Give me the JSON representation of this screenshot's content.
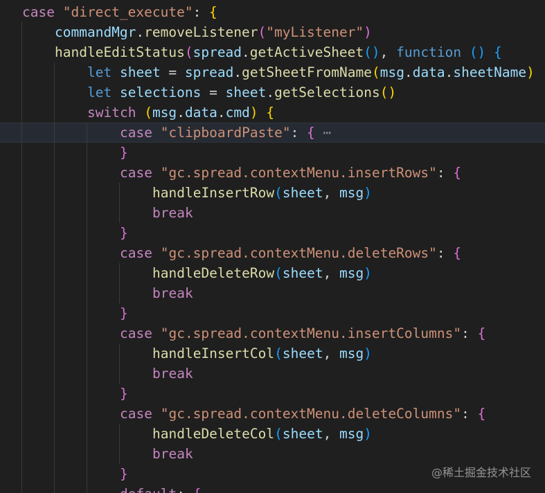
{
  "editor": {
    "lines": [
      {
        "indent": 0,
        "tokens": [
          {
            "text": "case",
            "c": "ctl"
          },
          {
            "text": " ",
            "c": "pun"
          },
          {
            "text": "\"direct_execute\"",
            "c": "str"
          },
          {
            "text": ": ",
            "c": "pun"
          },
          {
            "text": "{",
            "c": "b1"
          }
        ]
      },
      {
        "indent": 1,
        "tokens": [
          {
            "text": "commandMgr",
            "c": "var"
          },
          {
            "text": ".",
            "c": "pun"
          },
          {
            "text": "removeListener",
            "c": "fn"
          },
          {
            "text": "(",
            "c": "b2"
          },
          {
            "text": "\"myListener\"",
            "c": "str"
          },
          {
            "text": ")",
            "c": "b2"
          }
        ]
      },
      {
        "indent": 1,
        "tokens": [
          {
            "text": "handleEditStatus",
            "c": "fn"
          },
          {
            "text": "(",
            "c": "b2"
          },
          {
            "text": "spread",
            "c": "var"
          },
          {
            "text": ".",
            "c": "pun"
          },
          {
            "text": "getActiveSheet",
            "c": "fn"
          },
          {
            "text": "()",
            "c": "b3"
          },
          {
            "text": ", ",
            "c": "pun"
          },
          {
            "text": "function",
            "c": "kw"
          },
          {
            "text": " ",
            "c": "pun"
          },
          {
            "text": "()",
            "c": "b3"
          },
          {
            "text": " ",
            "c": "pun"
          },
          {
            "text": "{",
            "c": "b3"
          }
        ]
      },
      {
        "indent": 2,
        "tokens": [
          {
            "text": "let",
            "c": "kw"
          },
          {
            "text": " ",
            "c": "pun"
          },
          {
            "text": "sheet",
            "c": "var"
          },
          {
            "text": " = ",
            "c": "pun"
          },
          {
            "text": "spread",
            "c": "var"
          },
          {
            "text": ".",
            "c": "pun"
          },
          {
            "text": "getSheetFromName",
            "c": "fn"
          },
          {
            "text": "(",
            "c": "b1"
          },
          {
            "text": "msg",
            "c": "var"
          },
          {
            "text": ".",
            "c": "pun"
          },
          {
            "text": "data",
            "c": "var"
          },
          {
            "text": ".",
            "c": "pun"
          },
          {
            "text": "sheetName",
            "c": "var"
          },
          {
            "text": ")",
            "c": "b1"
          }
        ]
      },
      {
        "indent": 2,
        "tokens": [
          {
            "text": "let",
            "c": "kw"
          },
          {
            "text": " ",
            "c": "pun"
          },
          {
            "text": "selections",
            "c": "var"
          },
          {
            "text": " = ",
            "c": "pun"
          },
          {
            "text": "sheet",
            "c": "var"
          },
          {
            "text": ".",
            "c": "pun"
          },
          {
            "text": "getSelections",
            "c": "fn"
          },
          {
            "text": "()",
            "c": "b1"
          }
        ]
      },
      {
        "indent": 2,
        "tokens": [
          {
            "text": "switch",
            "c": "ctl"
          },
          {
            "text": " ",
            "c": "pun"
          },
          {
            "text": "(",
            "c": "b1"
          },
          {
            "text": "msg",
            "c": "var"
          },
          {
            "text": ".",
            "c": "pun"
          },
          {
            "text": "data",
            "c": "var"
          },
          {
            "text": ".",
            "c": "pun"
          },
          {
            "text": "cmd",
            "c": "var"
          },
          {
            "text": ")",
            "c": "b1"
          },
          {
            "text": " ",
            "c": "pun"
          },
          {
            "text": "{",
            "c": "b1"
          }
        ]
      },
      {
        "indent": 3,
        "current": true,
        "tokens": [
          {
            "text": "case",
            "c": "ctl"
          },
          {
            "text": " ",
            "c": "pun"
          },
          {
            "text": "\"clipboardPaste\"",
            "c": "str"
          },
          {
            "text": ": ",
            "c": "pun"
          },
          {
            "text": "{",
            "c": "b2"
          },
          {
            "text": " ",
            "c": "pun"
          },
          {
            "text": "⋯",
            "c": "fold"
          }
        ]
      },
      {
        "indent": 3,
        "tokens": [
          {
            "text": "}",
            "c": "b2"
          }
        ]
      },
      {
        "indent": 3,
        "tokens": [
          {
            "text": "case",
            "c": "ctl"
          },
          {
            "text": " ",
            "c": "pun"
          },
          {
            "text": "\"gc.spread.contextMenu.insertRows\"",
            "c": "str"
          },
          {
            "text": ": ",
            "c": "pun"
          },
          {
            "text": "{",
            "c": "b2"
          }
        ]
      },
      {
        "indent": 4,
        "tokens": [
          {
            "text": "handleInsertRow",
            "c": "fn"
          },
          {
            "text": "(",
            "c": "b3"
          },
          {
            "text": "sheet",
            "c": "var"
          },
          {
            "text": ", ",
            "c": "pun"
          },
          {
            "text": "msg",
            "c": "var"
          },
          {
            "text": ")",
            "c": "b3"
          }
        ]
      },
      {
        "indent": 4,
        "tokens": [
          {
            "text": "break",
            "c": "ctl"
          }
        ]
      },
      {
        "indent": 3,
        "tokens": [
          {
            "text": "}",
            "c": "b2"
          }
        ]
      },
      {
        "indent": 3,
        "tokens": [
          {
            "text": "case",
            "c": "ctl"
          },
          {
            "text": " ",
            "c": "pun"
          },
          {
            "text": "\"gc.spread.contextMenu.deleteRows\"",
            "c": "str"
          },
          {
            "text": ": ",
            "c": "pun"
          },
          {
            "text": "{",
            "c": "b2"
          }
        ]
      },
      {
        "indent": 4,
        "tokens": [
          {
            "text": "handleDeleteRow",
            "c": "fn"
          },
          {
            "text": "(",
            "c": "b3"
          },
          {
            "text": "sheet",
            "c": "var"
          },
          {
            "text": ", ",
            "c": "pun"
          },
          {
            "text": "msg",
            "c": "var"
          },
          {
            "text": ")",
            "c": "b3"
          }
        ]
      },
      {
        "indent": 4,
        "tokens": [
          {
            "text": "break",
            "c": "ctl"
          }
        ]
      },
      {
        "indent": 3,
        "tokens": [
          {
            "text": "}",
            "c": "b2"
          }
        ]
      },
      {
        "indent": 3,
        "tokens": [
          {
            "text": "case",
            "c": "ctl"
          },
          {
            "text": " ",
            "c": "pun"
          },
          {
            "text": "\"gc.spread.contextMenu.insertColumns\"",
            "c": "str"
          },
          {
            "text": ": ",
            "c": "pun"
          },
          {
            "text": "{",
            "c": "b2"
          }
        ]
      },
      {
        "indent": 4,
        "tokens": [
          {
            "text": "handleInsertCol",
            "c": "fn"
          },
          {
            "text": "(",
            "c": "b3"
          },
          {
            "text": "sheet",
            "c": "var"
          },
          {
            "text": ", ",
            "c": "pun"
          },
          {
            "text": "msg",
            "c": "var"
          },
          {
            "text": ")",
            "c": "b3"
          }
        ]
      },
      {
        "indent": 4,
        "tokens": [
          {
            "text": "break",
            "c": "ctl"
          }
        ]
      },
      {
        "indent": 3,
        "tokens": [
          {
            "text": "}",
            "c": "b2"
          }
        ]
      },
      {
        "indent": 3,
        "tokens": [
          {
            "text": "case",
            "c": "ctl"
          },
          {
            "text": " ",
            "c": "pun"
          },
          {
            "text": "\"gc.spread.contextMenu.deleteColumns\"",
            "c": "str"
          },
          {
            "text": ": ",
            "c": "pun"
          },
          {
            "text": "{",
            "c": "b2"
          }
        ]
      },
      {
        "indent": 4,
        "tokens": [
          {
            "text": "handleDeleteCol",
            "c": "fn"
          },
          {
            "text": "(",
            "c": "b3"
          },
          {
            "text": "sheet",
            "c": "var"
          },
          {
            "text": ", ",
            "c": "pun"
          },
          {
            "text": "msg",
            "c": "var"
          },
          {
            "text": ")",
            "c": "b3"
          }
        ]
      },
      {
        "indent": 4,
        "tokens": [
          {
            "text": "break",
            "c": "ctl"
          }
        ]
      },
      {
        "indent": 3,
        "tokens": [
          {
            "text": "}",
            "c": "b2"
          }
        ]
      },
      {
        "indent": 3,
        "tokens": [
          {
            "text": "default",
            "c": "ctl"
          },
          {
            "text": ": ",
            "c": "pun"
          },
          {
            "text": "{",
            "c": "b2"
          }
        ]
      }
    ]
  },
  "watermark": {
    "text": "@稀土掘金技术社区"
  },
  "colors": {
    "background": "#1f1f1f",
    "current_line": "#262b33",
    "keyword": "#569cd6",
    "control": "#c586c0",
    "string": "#ce9178",
    "function": "#dcdcaa",
    "variable": "#9cdcfe",
    "punctuation": "#d4d4d4",
    "bracket_level_1": "#ffd700",
    "bracket_level_2": "#da70d6",
    "bracket_level_3": "#179fff"
  }
}
